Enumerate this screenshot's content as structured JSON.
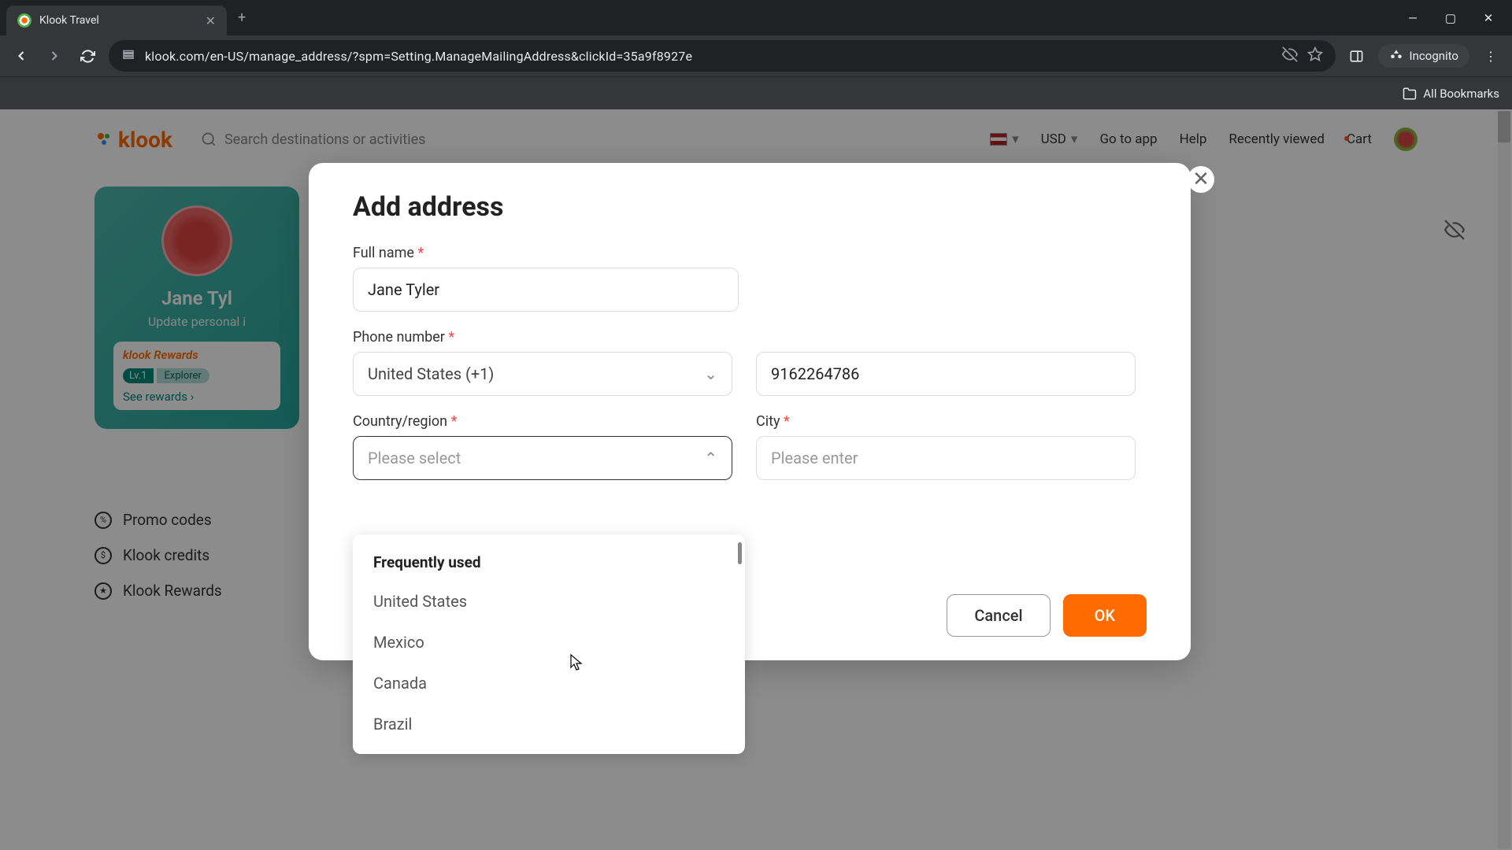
{
  "browser": {
    "tab_title": "Klook Travel",
    "url": "klook.com/en-US/manage_address/?spm=Setting.ManageMailingAddress&clickId=35a9f8927e",
    "incognito_label": "Incognito",
    "all_bookmarks": "All Bookmarks"
  },
  "header": {
    "logo": "klook",
    "search_placeholder": "Search destinations or activities",
    "currency": "USD",
    "go_to_app": "Go to app",
    "help": "Help",
    "recently_viewed": "Recently viewed",
    "cart": "Cart"
  },
  "profile": {
    "name": "Jane Tyl",
    "update": "Update personal i",
    "rewards_brand": "klook Rewards",
    "level": "Lv.1",
    "level_name": "Explorer",
    "see_rewards": "See rewards"
  },
  "sidenav": {
    "promo": "Promo codes",
    "credits": "Klook credits",
    "rewards": "Klook Rewards"
  },
  "modal": {
    "title": "Add address",
    "full_name_label": "Full name",
    "full_name_value": "Jane Tyler",
    "phone_label": "Phone number",
    "phone_country": "United States (+1)",
    "phone_value": "9162264786",
    "country_label": "Country/region",
    "country_value": "Please select",
    "city_label": "City",
    "city_placeholder": "Please enter",
    "cancel": "Cancel",
    "ok": "OK"
  },
  "dropdown": {
    "header": "Frequently used",
    "items": [
      "United States",
      "Mexico",
      "Canada",
      "Brazil"
    ]
  }
}
